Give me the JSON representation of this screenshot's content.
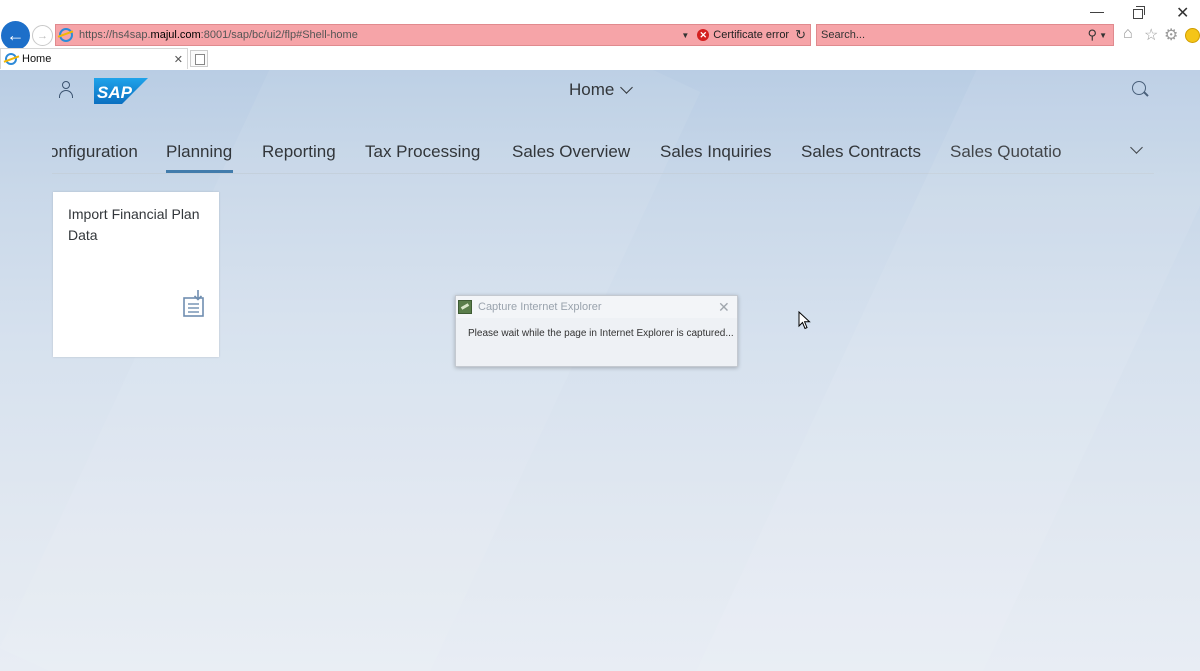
{
  "browser": {
    "url_prefix": "https://hs4sap.",
    "url_host": "majul.com",
    "url_suffix": ":8001/sap/bc/ui2/flp#Shell-home",
    "cert_error": "Certificate error",
    "search_placeholder": "Search...",
    "tab_title": "Home"
  },
  "shell": {
    "title": "Home"
  },
  "anchor_bar": {
    "items": [
      {
        "label": "onfiguration"
      },
      {
        "label": "Planning"
      },
      {
        "label": "Reporting"
      },
      {
        "label": "Tax Processing"
      },
      {
        "label": "Sales Overview"
      },
      {
        "label": "Sales Inquiries"
      },
      {
        "label": "Sales Contracts"
      },
      {
        "label": "Sales Quotatio"
      }
    ],
    "selected": "Planning"
  },
  "tile": {
    "title": "Import Financial Plan Data"
  },
  "dialog": {
    "title": "Capture Internet Explorer",
    "message": "Please wait while the page in Internet Explorer is captured..."
  },
  "colors": {
    "accent": "#427cac",
    "address_bar_error": "#f6a4a8",
    "sap_blue": "#1a8fd8"
  }
}
